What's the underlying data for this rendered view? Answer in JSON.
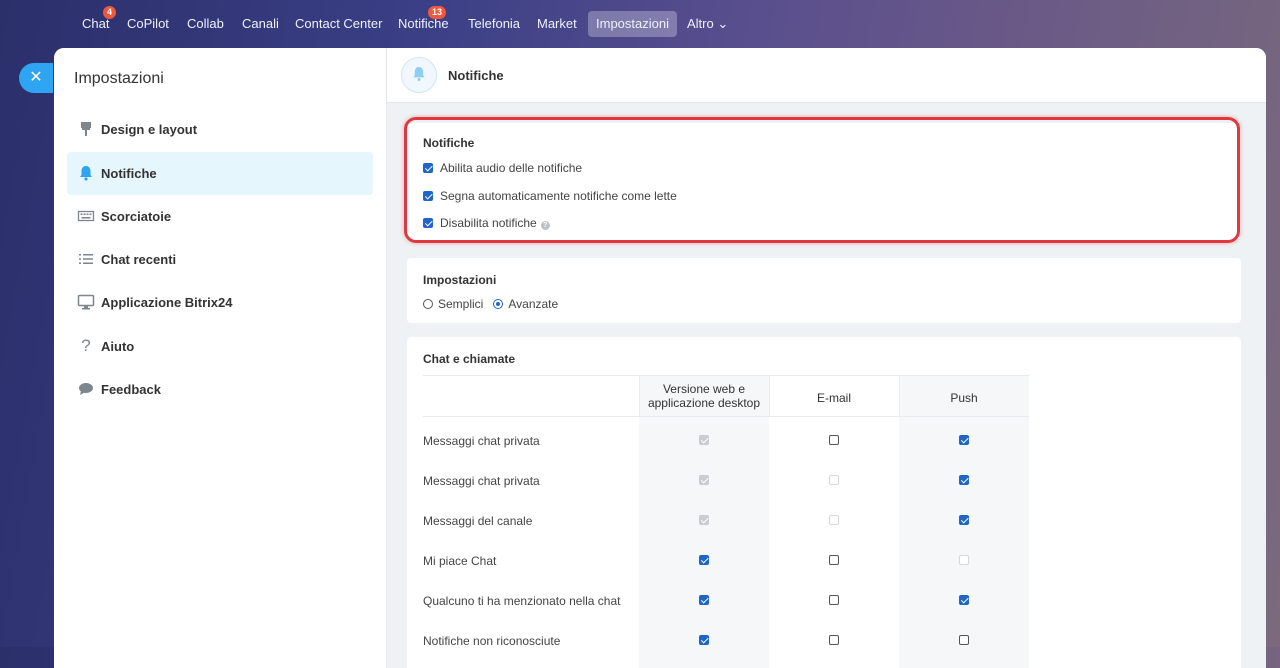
{
  "nav": {
    "items": [
      {
        "label": "Chat",
        "badge": "4"
      },
      {
        "label": "CoPilot"
      },
      {
        "label": "Collab"
      },
      {
        "label": "Canali"
      },
      {
        "label": "Contact Center"
      },
      {
        "label": "Notifiche",
        "badge": "13"
      },
      {
        "label": "Telefonia"
      },
      {
        "label": "Market"
      },
      {
        "label": "Impostazioni",
        "active": true
      },
      {
        "label": "Altro ⌄"
      }
    ]
  },
  "sidebar": {
    "title": "Impostazioni",
    "items": [
      {
        "label": "Design e layout",
        "icon": "brush-icon"
      },
      {
        "label": "Notifiche",
        "icon": "bell-icon",
        "active": true
      },
      {
        "label": "Scorciatoie",
        "icon": "keyboard-icon"
      },
      {
        "label": "Chat recenti",
        "icon": "list-icon"
      },
      {
        "label": "Applicazione Bitrix24",
        "icon": "monitor-icon"
      },
      {
        "label": "Aiuto",
        "icon": "question-icon"
      },
      {
        "label": "Feedback",
        "icon": "chat-bubble-icon"
      }
    ]
  },
  "header": {
    "title": "Notifiche"
  },
  "notifications_card": {
    "title": "Notifiche",
    "options": [
      {
        "label": "Abilita audio delle notifiche",
        "checked": true
      },
      {
        "label": "Segna automaticamente notifiche come lette",
        "checked": true
      },
      {
        "label": "Disabilita notifiche",
        "checked": true,
        "help": "?"
      }
    ]
  },
  "settings_card": {
    "title": "Impostazioni",
    "mode_simple": "Semplici",
    "mode_advanced": "Avanzate",
    "selected": "Avanzate"
  },
  "chat_card": {
    "title": "Chat e chiamate",
    "columns": [
      "Versione web e applicazione desktop",
      "E-mail",
      "Push"
    ],
    "rows": [
      {
        "label": "Messaggi chat privata",
        "cells": [
          "dis-on",
          "off",
          "on"
        ]
      },
      {
        "label": "Messaggi chat privata",
        "cells": [
          "dis-on",
          "dis-off",
          "on"
        ]
      },
      {
        "label": "Messaggi del canale",
        "cells": [
          "dis-on",
          "dis-off",
          "on"
        ]
      },
      {
        "label": "Mi piace Chat",
        "cells": [
          "on",
          "off",
          "dis-off"
        ]
      },
      {
        "label": "Qualcuno ti ha menzionato nella chat",
        "cells": [
          "on",
          "off",
          "on"
        ]
      },
      {
        "label": "Notifiche non riconosciute",
        "cells": [
          "on",
          "off",
          "off"
        ]
      }
    ]
  },
  "colors": {
    "accent": "#2fa4f2",
    "checkbox": "#2066c8",
    "highlight": "#e0383e",
    "badge": "#f2573b"
  }
}
